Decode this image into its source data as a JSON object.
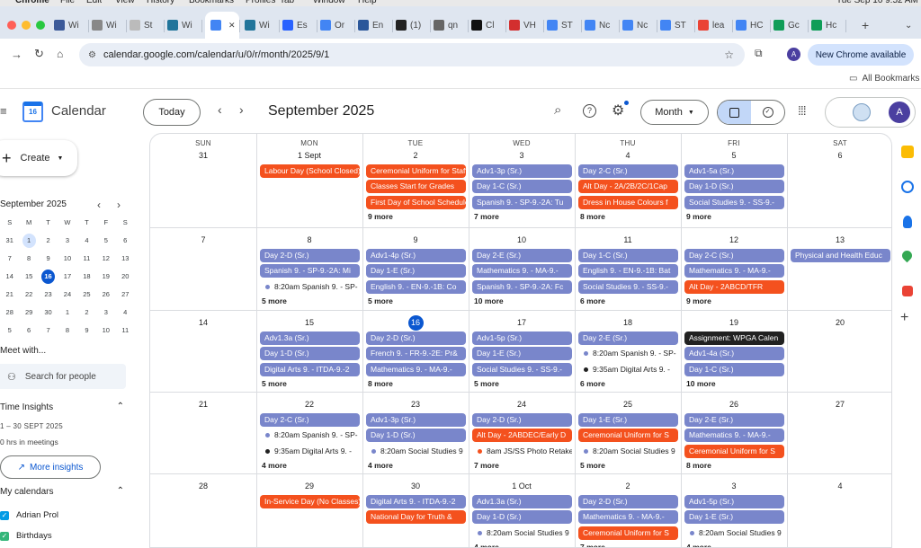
{
  "mac_menu": {
    "items": [
      "Chrome",
      "File",
      "Edit",
      "View",
      "History",
      "Bookmarks",
      "Profiles",
      "Tab",
      "Window",
      "Help"
    ],
    "clock": "Tue Sep 16  9:52 AM"
  },
  "tabs": [
    {
      "label": "Wi",
      "color": "#3c5a99"
    },
    {
      "label": "Wi",
      "color": "#888"
    },
    {
      "label": "St",
      "color": "#bbb"
    },
    {
      "label": "Wi",
      "color": "#21759b"
    },
    {
      "label": "",
      "color": "#4285f4",
      "active": true
    },
    {
      "label": "Wi",
      "color": "#21759b"
    },
    {
      "label": "Es",
      "color": "#2962ff"
    },
    {
      "label": "Or",
      "color": "#4285f4"
    },
    {
      "label": "En",
      "color": "#2b579a"
    },
    {
      "label": "(1)",
      "color": "#222"
    },
    {
      "label": "qn",
      "color": "#666"
    },
    {
      "label": "Cl",
      "color": "#111"
    },
    {
      "label": "VH",
      "color": "#d32f2f"
    },
    {
      "label": "ST",
      "color": "#4285f4"
    },
    {
      "label": "Nc",
      "color": "#4285f4"
    },
    {
      "label": "Nc",
      "color": "#4285f4"
    },
    {
      "label": "ST",
      "color": "#4285f4"
    },
    {
      "label": "lea",
      "color": "#ea4335"
    },
    {
      "label": "HC",
      "color": "#4285f4"
    },
    {
      "label": "Gc",
      "color": "#0f9d58"
    },
    {
      "label": "Hc",
      "color": "#0f9d58"
    }
  ],
  "address": {
    "url": "calendar.google.com/calendar/u/0/r/month/2025/9/1",
    "new_chrome": "New Chrome available",
    "all_bookmarks": "All Bookmarks",
    "avatar": "A"
  },
  "app": {
    "title": "Calendar",
    "logo_day": "16",
    "today_btn": "Today",
    "period": "September 2025",
    "view_btn": "Month",
    "avatar": "A"
  },
  "sidebar": {
    "create": "Create",
    "mini_title": "September 2025",
    "mini_days": [
      "S",
      "M",
      "T",
      "W",
      "T",
      "F",
      "S"
    ],
    "mini_weeks": [
      [
        "31",
        "1",
        "2",
        "3",
        "4",
        "5",
        "6"
      ],
      [
        "7",
        "8",
        "9",
        "10",
        "11",
        "12",
        "13"
      ],
      [
        "14",
        "15",
        "16",
        "17",
        "18",
        "19",
        "20"
      ],
      [
        "21",
        "22",
        "23",
        "24",
        "25",
        "26",
        "27"
      ],
      [
        "28",
        "29",
        "30",
        "1",
        "2",
        "3",
        "4"
      ],
      [
        "5",
        "6",
        "7",
        "8",
        "9",
        "10",
        "11"
      ]
    ],
    "meet_with": "Meet with...",
    "search_people": "Search for people",
    "time_insights": "Time Insights",
    "ti_range": "1 – 30 SEPT 2025",
    "ti_hours": "0 hrs in meetings",
    "more_insights": "More insights",
    "my_calendars": "My calendars",
    "calendars": [
      {
        "name": "Adrian Prol",
        "color": "#039be5"
      },
      {
        "name": "Birthdays",
        "color": "#33b679"
      }
    ]
  },
  "grid": {
    "day_headers": [
      "SUN",
      "MON",
      "TUE",
      "WED",
      "THU",
      "FRI",
      "SAT"
    ],
    "weeks": [
      {
        "days": [
          {
            "num": "31",
            "events": []
          },
          {
            "num": "1 Sept",
            "events": [
              {
                "t": "Labour Day (School Closed)",
                "c": "o"
              }
            ]
          },
          {
            "num": "2",
            "events": [
              {
                "t": "Ceremonial Uniform for Staff",
                "c": "o"
              },
              {
                "t": "Classes Start for Grades",
                "c": "o"
              },
              {
                "t": "First Day of School Schedule",
                "c": "o"
              }
            ],
            "more": "9 more"
          },
          {
            "num": "3",
            "events": [
              {
                "t": "Adv1-3p (Sr.)",
                "c": "p"
              },
              {
                "t": "Day 1-C (Sr.)",
                "c": "p"
              },
              {
                "t": "Spanish 9. - SP-9.-2A: Tu",
                "c": "p"
              }
            ],
            "more": "7 more"
          },
          {
            "num": "4",
            "events": [
              {
                "t": "Day 2-C (Sr.)",
                "c": "p"
              },
              {
                "t": "Alt Day - 2A/2B/2C/1Cap",
                "c": "o"
              },
              {
                "t": "Dress in House Colours f",
                "c": "o"
              }
            ],
            "more": "8 more"
          },
          {
            "num": "5",
            "events": [
              {
                "t": "Adv1-5a (Sr.)",
                "c": "p"
              },
              {
                "t": "Day 1-D (Sr.)",
                "c": "p"
              },
              {
                "t": "Social Studies 9. - SS-9.-",
                "c": "p"
              }
            ],
            "more": "9 more"
          },
          {
            "num": "6",
            "events": []
          }
        ]
      },
      {
        "days": [
          {
            "num": "7",
            "events": []
          },
          {
            "num": "8",
            "events": [
              {
                "t": "Day 2-D (Sr.)",
                "c": "p"
              },
              {
                "t": "Spanish 9. - SP-9.-2A: Mi",
                "c": "p"
              },
              {
                "t": "8:20am Spanish 9. - SP-",
                "c": "dot"
              }
            ],
            "more": "5 more"
          },
          {
            "num": "9",
            "events": [
              {
                "t": "Adv1-4p (Sr.)",
                "c": "p"
              },
              {
                "t": "Day 1-E (Sr.)",
                "c": "p"
              },
              {
                "t": "English 9. - EN-9.-1B: Co",
                "c": "p"
              }
            ],
            "more": "5 more"
          },
          {
            "num": "10",
            "events": [
              {
                "t": "Day 2-E (Sr.)",
                "c": "p"
              },
              {
                "t": "Mathematics 9. - MA-9.-",
                "c": "p"
              },
              {
                "t": "Spanish 9. - SP-9.-2A: Fc",
                "c": "p"
              }
            ],
            "more": "10 more"
          },
          {
            "num": "11",
            "events": [
              {
                "t": "Day 1-C (Sr.)",
                "c": "p"
              },
              {
                "t": "English 9. - EN-9.-1B: Bat",
                "c": "p"
              },
              {
                "t": "Social Studies 9. - SS-9.-",
                "c": "p"
              }
            ],
            "more": "6 more"
          },
          {
            "num": "12",
            "events": [
              {
                "t": "Day 2-C (Sr.)",
                "c": "p"
              },
              {
                "t": "Mathematics 9. - MA-9.-",
                "c": "p"
              },
              {
                "t": "Alt Day - 2ABCD/TFR",
                "c": "o"
              }
            ],
            "more": "9 more"
          },
          {
            "num": "13",
            "events": [
              {
                "t": "Physical and Health Educ",
                "c": "p"
              }
            ]
          }
        ]
      },
      {
        "days": [
          {
            "num": "14",
            "events": []
          },
          {
            "num": "15",
            "events": [
              {
                "t": "Adv1.3a (Sr.)",
                "c": "p"
              },
              {
                "t": "Day 1-D (Sr.)",
                "c": "p"
              },
              {
                "t": "Digital Arts 9. - ITDA-9.-2",
                "c": "p"
              }
            ],
            "more": "5 more"
          },
          {
            "num": "16",
            "today": true,
            "events": [
              {
                "t": "Day 2-D (Sr.)",
                "c": "p"
              },
              {
                "t": "French 9. - FR-9.-2E: Pr&",
                "c": "p"
              },
              {
                "t": "Mathematics 9. - MA-9.-",
                "c": "p"
              }
            ],
            "more": "8 more"
          },
          {
            "num": "17",
            "events": [
              {
                "t": "Adv1-5p (Sr.)",
                "c": "p"
              },
              {
                "t": "Day 1-E (Sr.)",
                "c": "p"
              },
              {
                "t": "Social Studies 9. - SS-9.-",
                "c": "p"
              }
            ],
            "more": "5 more"
          },
          {
            "num": "18",
            "events": [
              {
                "t": "Day 2-E (Sr.)",
                "c": "p"
              },
              {
                "t": "8:20am Spanish 9. - SP-",
                "c": "dot"
              },
              {
                "t": "9:35am Digital Arts 9. -",
                "c": "dot",
                "dc": "#212121"
              }
            ],
            "more": "6 more"
          },
          {
            "num": "19",
            "events": [
              {
                "t": "Assignment: WPGA Calen",
                "c": "k"
              },
              {
                "t": "Adv1-4a (Sr.)",
                "c": "p"
              },
              {
                "t": "Day 1-C (Sr.)",
                "c": "p"
              }
            ],
            "more": "10 more"
          },
          {
            "num": "20",
            "events": []
          }
        ]
      },
      {
        "days": [
          {
            "num": "21",
            "events": []
          },
          {
            "num": "22",
            "events": [
              {
                "t": "Day 2-C (Sr.)",
                "c": "p"
              },
              {
                "t": "8:20am Spanish 9. - SP-",
                "c": "dot"
              },
              {
                "t": "9:35am Digital Arts 9. -",
                "c": "dot",
                "dc": "#212121"
              }
            ],
            "more": "4 more"
          },
          {
            "num": "23",
            "events": [
              {
                "t": "Adv1-3p (Sr.)",
                "c": "p"
              },
              {
                "t": "Day 1-D (Sr.)",
                "c": "p"
              },
              {
                "t": "8:20am Social Studies 9",
                "c": "dot"
              }
            ],
            "more": "4 more"
          },
          {
            "num": "24",
            "events": [
              {
                "t": "Day 2-D (Sr.)",
                "c": "p"
              },
              {
                "t": "Alt Day - 2ABDEC/Early D",
                "c": "o"
              },
              {
                "t": "8am JS/SS Photo Retake",
                "c": "dot",
                "dc": "#f4511e"
              }
            ],
            "more": "7 more"
          },
          {
            "num": "25",
            "events": [
              {
                "t": "Day 1-E (Sr.)",
                "c": "p"
              },
              {
                "t": "Ceremonial Uniform for S",
                "c": "o"
              },
              {
                "t": "8:20am Social Studies 9",
                "c": "dot"
              }
            ],
            "more": "5 more"
          },
          {
            "num": "26",
            "events": [
              {
                "t": "Day 2-E (Sr.)",
                "c": "p"
              },
              {
                "t": "Mathematics 9. - MA-9.-",
                "c": "p"
              },
              {
                "t": "Ceremonial Uniform for S",
                "c": "o"
              }
            ],
            "more": "8 more"
          },
          {
            "num": "27",
            "events": []
          }
        ]
      },
      {
        "days": [
          {
            "num": "28",
            "events": []
          },
          {
            "num": "29",
            "events": [
              {
                "t": "In-Service Day (No Classes)",
                "c": "o"
              }
            ]
          },
          {
            "num": "30",
            "events": [
              {
                "t": "Digital Arts 9. - ITDA-9.-2",
                "c": "p"
              },
              {
                "t": "National Day for Truth &",
                "c": "o"
              }
            ]
          },
          {
            "num": "1 Oct",
            "events": [
              {
                "t": "Adv1.3a (Sr.)",
                "c": "p"
              },
              {
                "t": "Day 1-D (Sr.)",
                "c": "p"
              },
              {
                "t": "8:20am Social Studies 9",
                "c": "dot"
              }
            ],
            "more": "4 more"
          },
          {
            "num": "2",
            "events": [
              {
                "t": "Day 2-D (Sr.)",
                "c": "p"
              },
              {
                "t": "Mathematics 9. - MA-9.-",
                "c": "p"
              },
              {
                "t": "Ceremonial Uniform for S",
                "c": "o"
              }
            ],
            "more": "7 more"
          },
          {
            "num": "3",
            "events": [
              {
                "t": "Adv1-5p (Sr.)",
                "c": "p"
              },
              {
                "t": "Day 1-E (Sr.)",
                "c": "p"
              },
              {
                "t": "8:20am Social Studies 9",
                "c": "dot"
              }
            ],
            "more": "4 more"
          },
          {
            "num": "4",
            "events": []
          }
        ]
      }
    ]
  }
}
